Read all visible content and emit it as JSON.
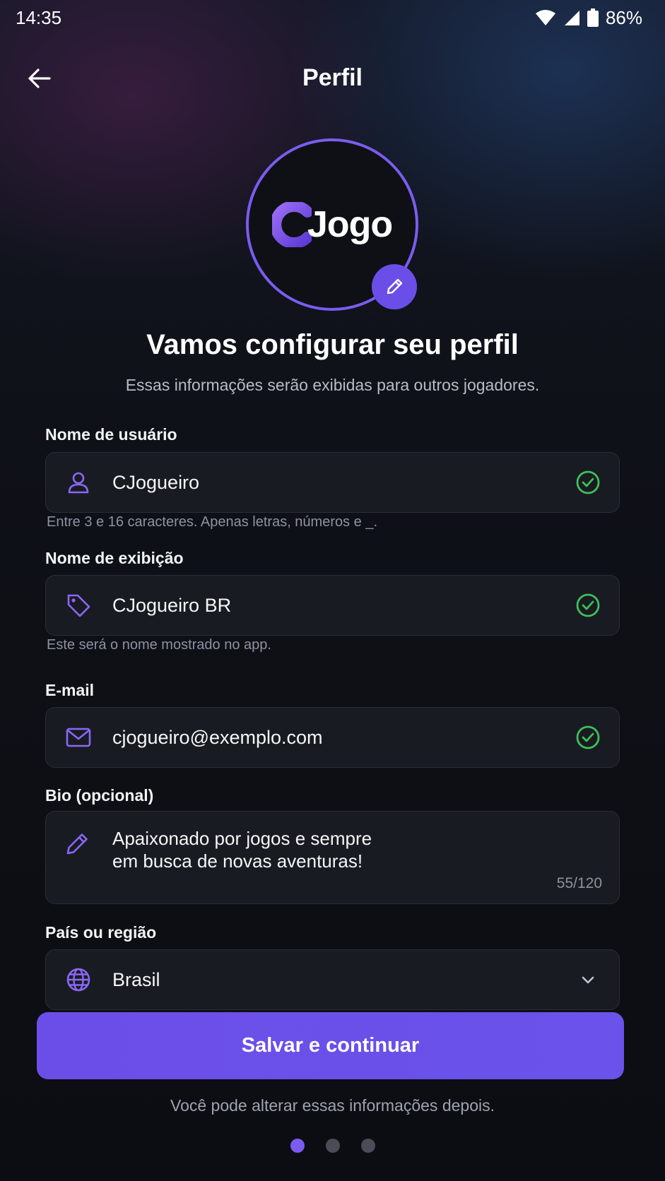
{
  "status_bar": {
    "time": "14:35",
    "battery": "86%"
  },
  "header": {
    "title": "Perfil"
  },
  "avatar": {
    "logo_text": "Jogo",
    "logo_letter": "C"
  },
  "intro": {
    "title": "Vamos configurar seu perfil",
    "subtitle": "Essas informações serão exibidas para outros jogadores."
  },
  "form": {
    "username": {
      "label": "Nome de usuário",
      "value": "CJogueiro",
      "hint": "Entre 3 e 16 caracteres. Apenas letras, números e _."
    },
    "display_name": {
      "label": "Nome de exibição",
      "value": "CJogueiro BR",
      "hint": "Este será o nome mostrado no app."
    },
    "email": {
      "label": "E-mail",
      "value": "cjogueiro@exemplo.com"
    },
    "bio": {
      "label": "Bio (opcional)",
      "line1": "Apaixonado por jogos e sempre",
      "line2": "em busca de novas aventuras!",
      "counter": "55/120"
    },
    "country": {
      "label": "País ou região",
      "value": "Brasil"
    }
  },
  "actions": {
    "save_label": "Salvar e continuar"
  },
  "footer": {
    "note": "Você pode alterar essas informações depois."
  },
  "pager": {
    "total": 3,
    "active": 1
  },
  "colors": {
    "accent": "#6b4ee8",
    "success": "#3fbf5a",
    "background": "#0c0d12"
  },
  "icons": [
    "wifi-icon",
    "signal-icon",
    "battery-icon",
    "back-arrow-icon",
    "pencil-icon",
    "user-icon",
    "tag-icon",
    "mail-icon",
    "globe-icon",
    "check-circle-icon",
    "chevron-down-icon"
  ]
}
